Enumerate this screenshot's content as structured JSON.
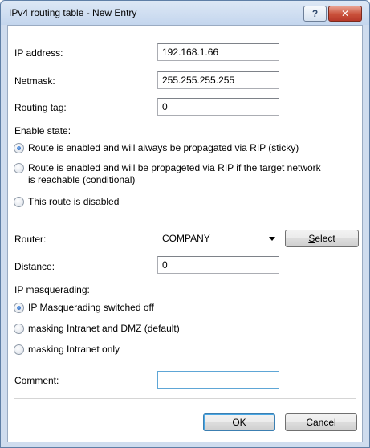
{
  "window": {
    "title": "IPv4 routing table - New Entry",
    "help_label": "?",
    "close_label": "✕"
  },
  "fields": {
    "ip_address": {
      "label": "IP address:",
      "value": "192.168.1.66"
    },
    "netmask": {
      "label": "Netmask:",
      "value": "255.255.255.255"
    },
    "routing_tag": {
      "label": "Routing tag:",
      "value": "0"
    },
    "router": {
      "label": "Router:",
      "value": "COMPANY"
    },
    "distance": {
      "label": "Distance:",
      "value": "0"
    },
    "comment": {
      "label": "Comment:",
      "value": ""
    }
  },
  "enable_state": {
    "label": "Enable state:",
    "options": [
      {
        "label": "Route is enabled and will always be propagated via RIP (sticky)",
        "checked": true
      },
      {
        "label": "Route is enabled and will be propageted via RIP if the target network is reachable (conditional)",
        "checked": false
      },
      {
        "label": "This route is disabled",
        "checked": false
      }
    ]
  },
  "ip_masquerading": {
    "label": "IP masquerading:",
    "options": [
      {
        "label": "IP Masquerading switched off",
        "checked": true
      },
      {
        "label": "masking Intranet and DMZ (default)",
        "checked": false
      },
      {
        "label": "masking Intranet only",
        "checked": false
      }
    ]
  },
  "buttons": {
    "select_mnemonic": "S",
    "select_rest": "elect",
    "ok": "OK",
    "cancel": "Cancel"
  },
  "colors": {
    "accent": "#1b56b5",
    "title_bar": "#c4d6ee",
    "close_button": "#c9503a"
  }
}
